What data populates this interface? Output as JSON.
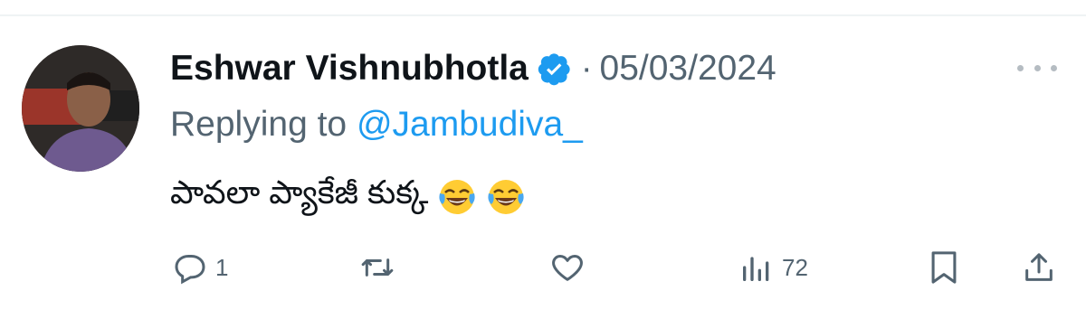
{
  "tweet": {
    "author_name": "Eshwar Vishnubhotla",
    "separator": "·",
    "date": "05/03/2024",
    "reply_prefix": "Replying to ",
    "reply_handle": "@Jambudiva_",
    "text": "పావలా ప్యాకేజీ కుక్క",
    "emojis": [
      "face-with-tears-of-joy",
      "face-with-tears-of-joy"
    ],
    "verified": true
  },
  "actions": {
    "reply_count": "1",
    "views_count": "72"
  },
  "icons": {
    "verified": "verified-badge-icon",
    "more": "more-options-icon",
    "reply": "reply-icon",
    "retweet": "retweet-icon",
    "like": "like-icon",
    "views": "views-icon",
    "bookmark": "bookmark-icon",
    "share": "share-icon"
  },
  "colors": {
    "text_primary": "#0f1419",
    "text_secondary": "#536471",
    "accent": "#1d9bf0"
  }
}
